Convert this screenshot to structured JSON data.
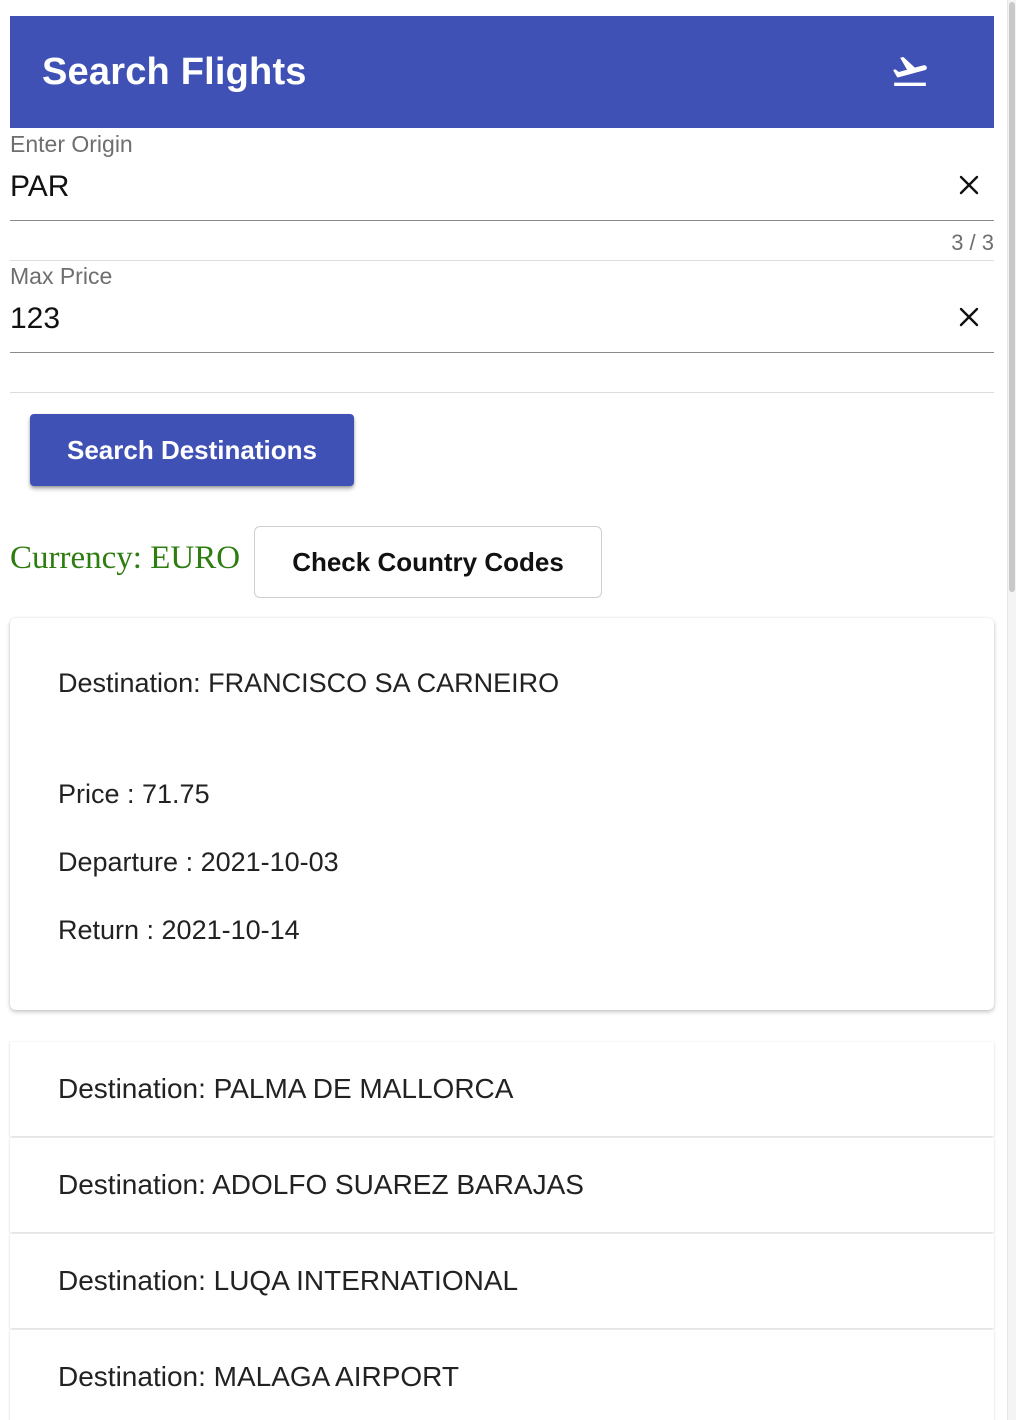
{
  "header": {
    "title": "Search Flights",
    "icon": "flight-takeoff-icon",
    "background_color": "#3f51b5"
  },
  "origin_field": {
    "label": "Enter Origin",
    "value": "PAR",
    "counter": "3 / 3",
    "clear_icon": "close-icon"
  },
  "price_field": {
    "label": "Max Price",
    "value": "123",
    "clear_icon": "close-icon"
  },
  "search_button": {
    "label": "Search Destinations"
  },
  "currency": {
    "text": "Currency: EURO",
    "color": "#2e7d10"
  },
  "check_codes_button": {
    "label": "Check Country Codes"
  },
  "expanded_result": {
    "destination": "Destination: FRANCISCO SA CARNEIRO",
    "price": "Price : 71.75",
    "departure": "Departure : 2021-10-03",
    "return": "Return : 2021-10-14"
  },
  "results": [
    {
      "destination": "Destination: PALMA DE MALLORCA"
    },
    {
      "destination": "Destination: ADOLFO SUAREZ BARAJAS"
    },
    {
      "destination": "Destination: LUQA INTERNATIONAL"
    },
    {
      "destination": "Destination: MALAGA AIRPORT"
    }
  ]
}
